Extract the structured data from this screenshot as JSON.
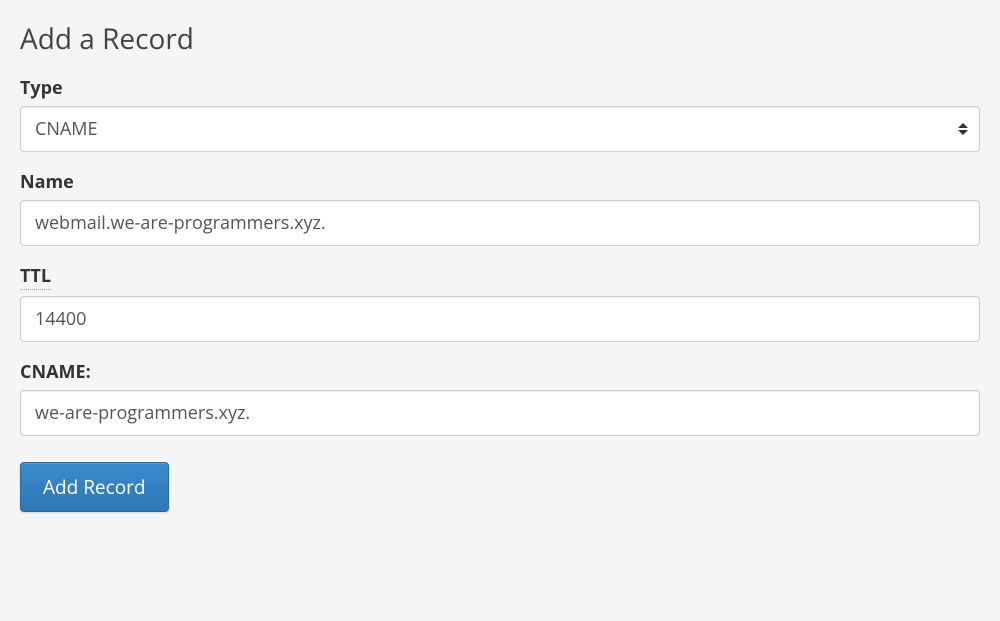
{
  "heading": "Add a Record",
  "form": {
    "type": {
      "label": "Type",
      "value": "CNAME"
    },
    "name": {
      "label": "Name",
      "value": "webmail.we-are-programmers.xyz."
    },
    "ttl": {
      "label": "TTL",
      "value": "14400"
    },
    "cname": {
      "label": "CNAME:",
      "value": "we-are-programmers.xyz."
    }
  },
  "button": {
    "submit": "Add Record"
  }
}
